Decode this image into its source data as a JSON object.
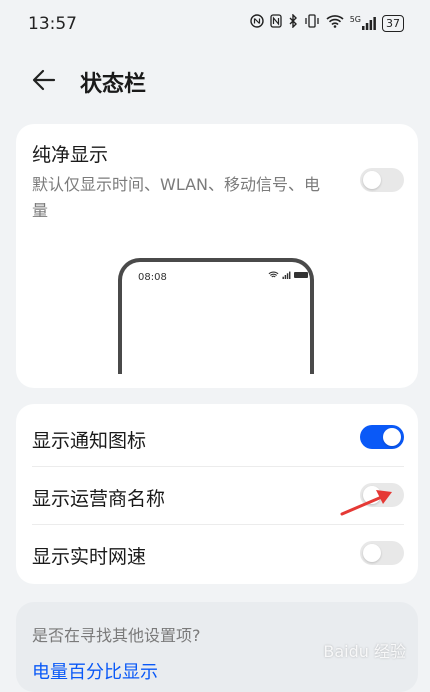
{
  "status_bar": {
    "time": "13:57",
    "network": "5G",
    "battery": "37"
  },
  "header": {
    "title": "状态栏"
  },
  "pure_display": {
    "title": "纯净显示",
    "description": "默认仅显示时间、WLAN、移动信号、电量",
    "toggle_on": false,
    "preview_time": "08:08"
  },
  "settings": {
    "items": [
      {
        "label": "显示通知图标",
        "on": true
      },
      {
        "label": "显示运营商名称",
        "on": false
      },
      {
        "label": "显示实时网速",
        "on": false
      }
    ]
  },
  "search_suggest": {
    "question": "是否在寻找其他设置项?",
    "link": "电量百分比显示"
  },
  "watermark": "Baidu 经验",
  "colors": {
    "accent": "#0a59f7",
    "background": "#f1f3f5",
    "annotation_arrow": "#e53935"
  }
}
